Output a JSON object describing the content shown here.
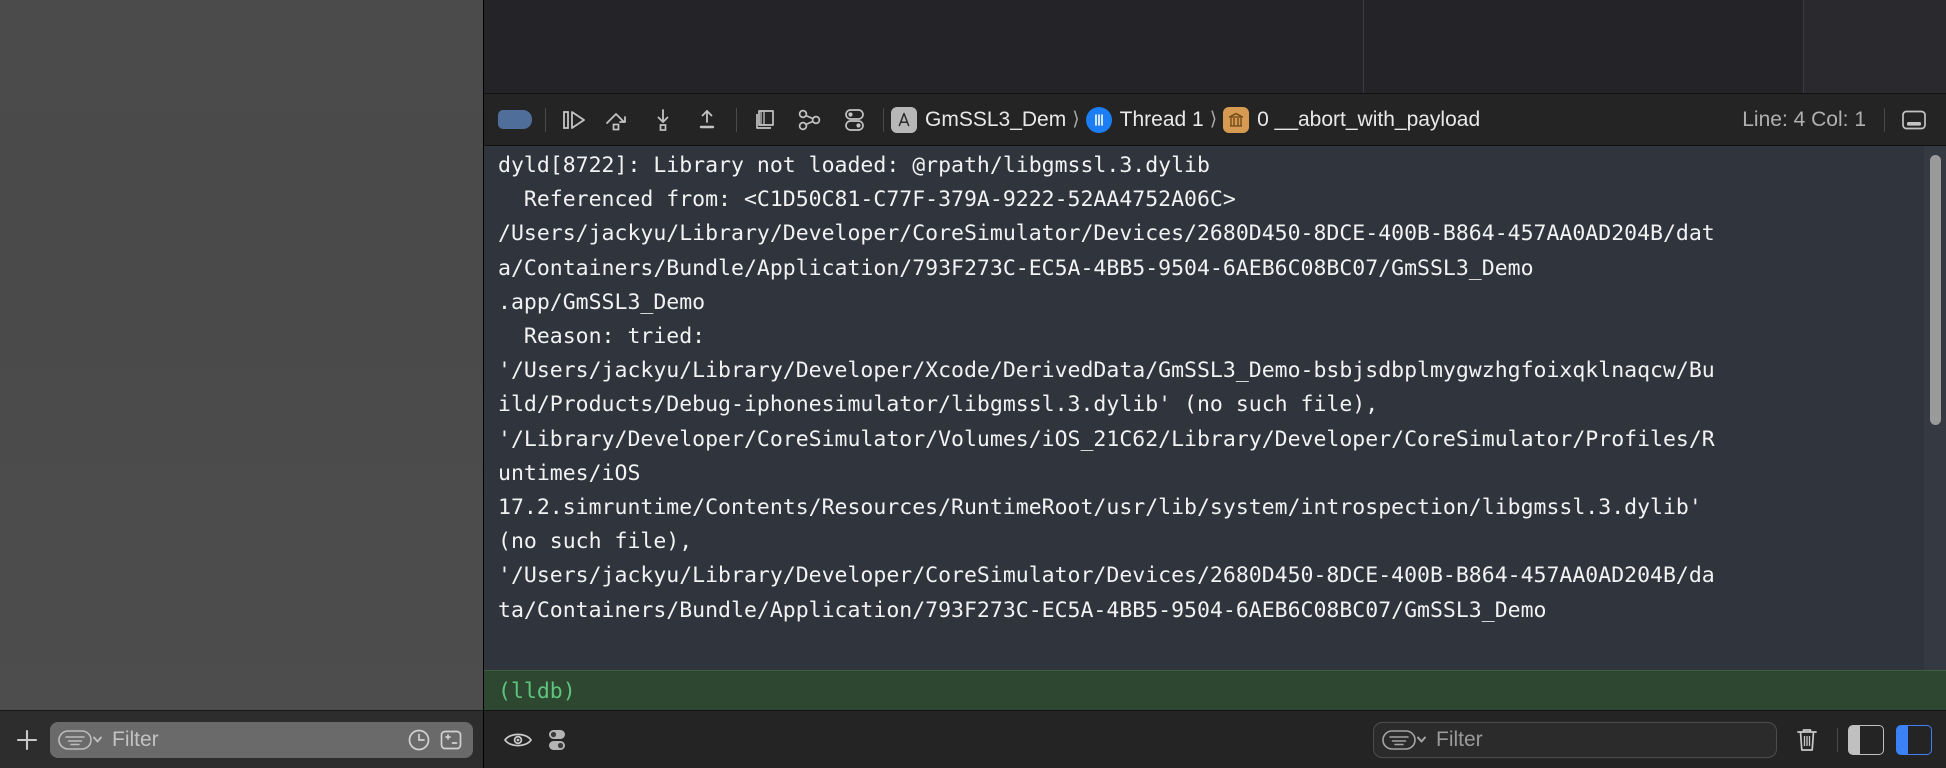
{
  "window": {
    "app": "Xcode",
    "theme_bg": "#232328",
    "console_bg": "#2f343d",
    "accent_blue": "#3b82f6",
    "lldb_bg": "#2d4730",
    "lldb_fg": "#5fc47e"
  },
  "navigator": {
    "bottom_bar": {
      "add_label": "+",
      "filter_placeholder": "Filter",
      "icons": [
        "add-icon",
        "filter-dropdown-icon",
        "recent-clock-icon",
        "show-only-changed-icon"
      ]
    }
  },
  "debug_toolbar": {
    "breakpoints_toggle": "breakpoints-activated",
    "buttons": [
      {
        "name": "continue-button",
        "icon": "continue-icon"
      },
      {
        "name": "step-over-button",
        "icon": "step-over-icon"
      },
      {
        "name": "step-into-button",
        "icon": "step-into-icon"
      },
      {
        "name": "step-out-button",
        "icon": "step-out-icon"
      },
      {
        "name": "debug-view-hierarchy-button",
        "icon": "view-hierarchy-icon"
      },
      {
        "name": "debug-memory-graph-button",
        "icon": "memory-graph-icon"
      },
      {
        "name": "environment-overrides-button",
        "icon": "environment-overrides-icon"
      }
    ],
    "breadcrumb": {
      "process": "GmSSL3_Dem",
      "thread": "Thread 1",
      "frame": "0 __abort_with_payload",
      "separator": "⟩"
    },
    "line_col": "Line: 4  Col: 1",
    "console_toggle": "toggle-console-icon"
  },
  "console": {
    "output": "dyld[8722]: Library not loaded: @rpath/libgmssl.3.dylib\n  Referenced from: <C1D50C81-C77F-379A-9222-52AA4752A06C>\n/Users/jackyu/Library/Developer/CoreSimulator/Devices/2680D450-8DCE-400B-B864-457AA0AD204B/dat\na/Containers/Bundle/Application/793F273C-EC5A-4BB5-9504-6AEB6C08BC07/GmSSL3_Demo\n.app/GmSSL3_Demo\n  Reason: tried:\n'/Users/jackyu/Library/Developer/Xcode/DerivedData/GmSSL3_Demo-bsbjsdbplmygwzhgfoixqklnaqcw/Bu\nild/Products/Debug-iphonesimulator/libgmssl.3.dylib' (no such file),\n'/Library/Developer/CoreSimulator/Volumes/iOS_21C62/Library/Developer/CoreSimulator/Profiles/R\nuntimes/iOS\n17.2.simruntime/Contents/Resources/RuntimeRoot/usr/lib/system/introspection/libgmssl.3.dylib'\n(no such file),\n'/Users/jackyu/Library/Developer/CoreSimulator/Devices/2680D450-8DCE-400B-B864-457AA0AD204B/da\nta/Containers/Bundle/Application/793F273C-EC5A-4BB5-9504-6AEB6C08BC07/GmSSL3_Demo",
    "prompt": "(lldb)"
  },
  "console_bottom_bar": {
    "show_debug_area_icon": "eye-icon",
    "filter_options_icon": "toggles-icon",
    "filter_placeholder": "Filter",
    "clear_icon": "trash-icon",
    "variables_pane_toggle": "left-panel-toggle-icon",
    "console_pane_toggle": "right-panel-toggle-icon"
  }
}
